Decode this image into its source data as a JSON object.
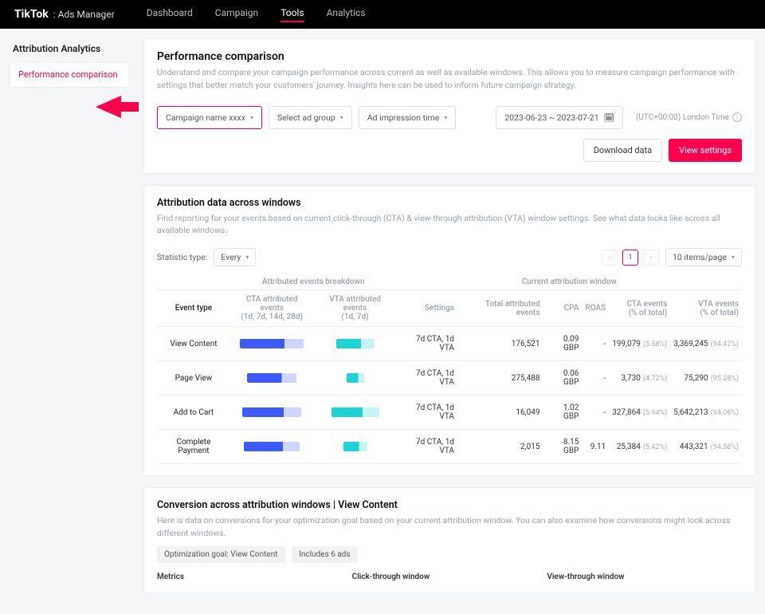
{
  "brand": {
    "name": "TikTok",
    "suffix": ": Ads Manager"
  },
  "nav": {
    "dashboard": "Dashboard",
    "campaign": "Campaign",
    "tools": "Tools",
    "analytics": "Analytics"
  },
  "sidebar": {
    "title": "Attribution Analytics",
    "item": "Performance comparison"
  },
  "header": {
    "title": "Performance comparison",
    "desc": "Understand and compare your campaign performance across current as well as available windows. This allows you to measure campaign performance with settings that better match your customers' journey. Insights here can be used to inform future campaign strategy."
  },
  "filters": {
    "campaign": "Campaign name xxxx",
    "adgroup": "Select ad group",
    "time": "Ad impression time",
    "date": "2023-06-23 ~ 2023-07-21",
    "tz": "(UTC+00:00) London Time"
  },
  "actions": {
    "download": "Download data",
    "view": "View settings"
  },
  "section1": {
    "title": "Attribution data across windows",
    "desc": "Find reporting for your events based on current click-through (CTA) & view-through attribution (VTA) window settings. See what data looks like across all available windows.",
    "stat_label": "Statistic type:",
    "stat_value": "Every",
    "page": "1",
    "ipp": "10 items/page"
  },
  "thead": {
    "g1": "Attributed events breakdown",
    "g2": "Current attribution window",
    "c0": "Event type",
    "c1": "CTA attributed events\n(1d, 7d, 14d, 28d)",
    "c2": "VTA attributed events\n(1d, 7d)",
    "c3": "Settings",
    "c4": "Total attributed events",
    "c5": "CPA",
    "c6": "ROAS",
    "c7": "CTA events\n(% of total)",
    "c8": "VTA events\n(% of total)"
  },
  "rows": [
    {
      "ev": "View Content",
      "set": "7d CTA, 1d VTA",
      "tot": "176,521",
      "cpa": "0.09 GBP",
      "roas": "-",
      "cta": "199,079",
      "ctap": "(5.58%)",
      "vta": "3,369,245",
      "vtap": "(94.42%)",
      "bw": 80,
      "tw": 48
    },
    {
      "ev": "Page View",
      "set": "7d CTA, 1d VTA",
      "tot": "275,488",
      "cpa": "0.06 GBP",
      "roas": "-",
      "cta": "3,730",
      "ctap": "(4.72%)",
      "vta": "75,290",
      "vtap": "(95.28%)",
      "bw": 62,
      "tw": 22
    },
    {
      "ev": "Add to Cart",
      "set": "7d CTA, 1d VTA",
      "tot": "16,049",
      "cpa": "1.02 GBP",
      "roas": "-",
      "cta": "327,864",
      "ctap": "(5.94%)",
      "vta": "5,642,213",
      "vtap": "(94.06%)",
      "bw": 74,
      "tw": 60
    },
    {
      "ev": "Complete Payment",
      "set": "7d CTA, 1d VTA",
      "tot": "2,015",
      "cpa": "8.15 GBP",
      "roas": "9.11",
      "cta": "25,384",
      "ctap": "(5.42%)",
      "vta": "443,321",
      "vtap": "(94.58%)",
      "bw": 70,
      "tw": 30
    }
  ],
  "section2": {
    "title": "Conversion across attribution windows | View Content",
    "desc": "Here is data on conversions for your optimization goal based on your current attribution window. You can also examine how conversions might look across different windows.",
    "chip1": "Optimization goal: View Content",
    "chip2": "Includes 6 ads",
    "col1": "Metrics",
    "col2": "Click-through window",
    "col3": "View-through window"
  }
}
